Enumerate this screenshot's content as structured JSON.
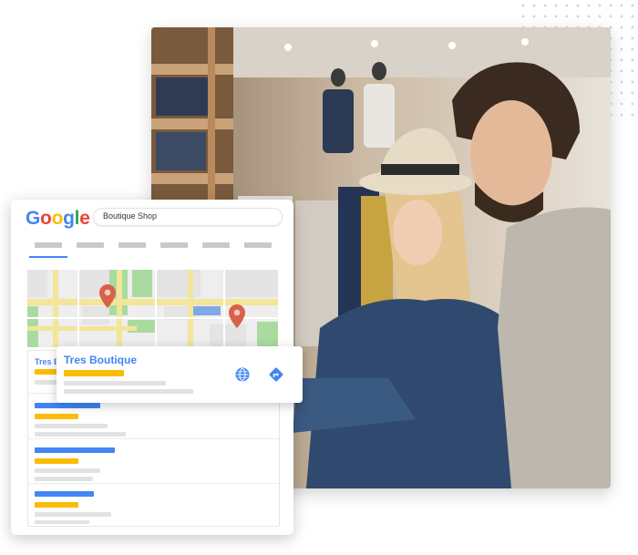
{
  "search": {
    "query": "Boutique Shop"
  },
  "logo": {
    "letters": [
      "G",
      "o",
      "o",
      "g",
      "l",
      "e"
    ],
    "colors": [
      "#4285F4",
      "#EA4335",
      "#FBBC05",
      "#4285F4",
      "#34A853",
      "#EA4335"
    ]
  },
  "listing": {
    "title": "Tres Boutique",
    "peek_text": "Tres B"
  },
  "colors": {
    "blue": "#4285F4",
    "yellow": "#FBBC05",
    "pin": "#D9614A",
    "road": "#F3E59A",
    "park": "#A9DBA0"
  },
  "icons": {
    "website": "globe-icon",
    "directions": "directions-icon",
    "map_pin": "map-pin-icon"
  }
}
